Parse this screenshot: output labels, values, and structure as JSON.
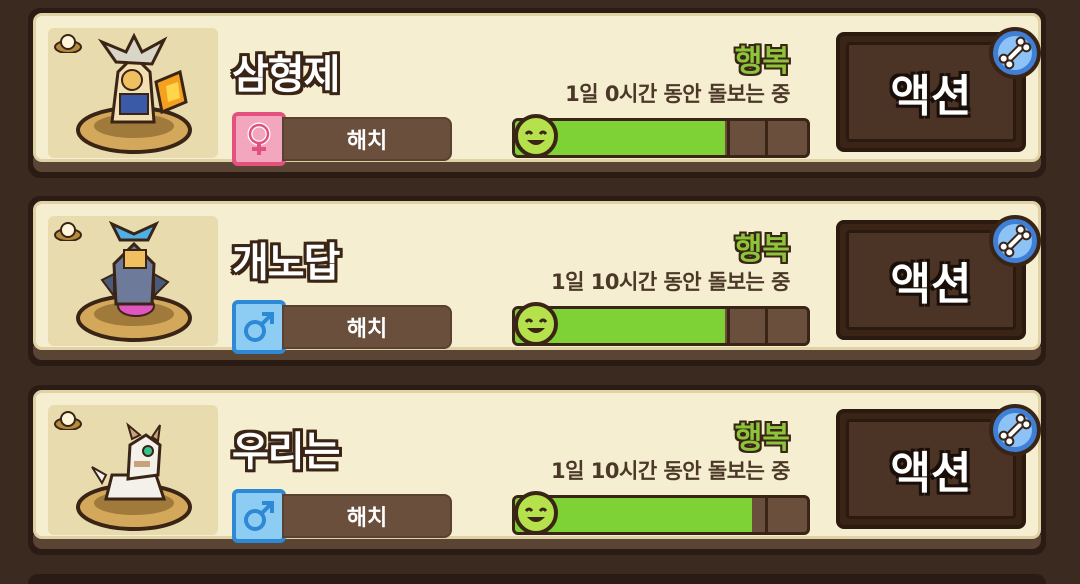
{
  "pets": [
    {
      "name": "삼형제",
      "gender": "female",
      "status": "해치",
      "mood": "행복",
      "care_time": "1일 0시간 동안 돌보는 중",
      "happiness_fraction": 0.72,
      "action_label": "액션",
      "art": "gold-winged-knight"
    },
    {
      "name": "개노답",
      "gender": "male",
      "status": "해치",
      "mood": "행복",
      "care_time": "1일 10시간 동안 돌보는 중",
      "happiness_fraction": 0.72,
      "action_label": "액션",
      "art": "blue-armored-dragon"
    },
    {
      "name": "우리는",
      "gender": "male",
      "status": "해치",
      "mood": "행복",
      "care_time": "1일 10시간 동안 돌보는 중",
      "happiness_fraction": 0.81,
      "action_label": "액션",
      "art": "white-cat-creature"
    }
  ],
  "colors": {
    "mood_green": "#8cc53a",
    "bar_fill": "#7fd236",
    "female": "#e5517f",
    "male": "#2d88d6",
    "card_bg": "#f6eed0"
  },
  "icons": {
    "egg": "egg-icon",
    "female": "female-symbol-icon",
    "male": "male-symbol-icon",
    "face": "smiley-face-icon",
    "badge": "bone-badge-icon"
  }
}
